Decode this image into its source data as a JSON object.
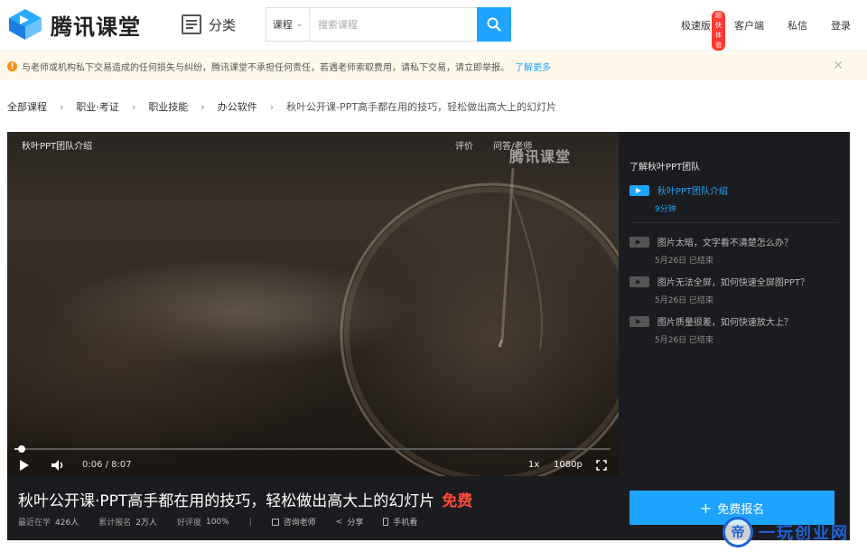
{
  "header": {
    "logo_text": "腾讯课堂",
    "category_label": "分类",
    "search": {
      "scope": "课程",
      "placeholder": "搜索课程"
    },
    "nav": {
      "fast": "极速版",
      "fast_badge": "超快体验",
      "client": "客户端",
      "messages": "私信",
      "login": "登录"
    }
  },
  "notice": {
    "text": "与老师或机构私下交易造成的任何损失与纠纷，腾讯课堂不承担任何责任，若遇老师索取费用，请私下交易，请立即举报。",
    "more": "了解更多"
  },
  "breadcrumb": [
    "全部课程",
    "职业·考证",
    "职业技能",
    "办公软件",
    "秋叶公开课-PPT高手都在用的技巧，轻松做出高大上的幻灯片"
  ],
  "player": {
    "title": "秋叶PPT团队介绍",
    "links": [
      "评价",
      "问答/老师"
    ],
    "watermark": "腾讯课堂",
    "time": "0:06 / 8:07",
    "speed": "1x",
    "quality": "1080p",
    "progress": 0.012
  },
  "side": {
    "heading": "了解秋叶PPT团队",
    "items": [
      {
        "title": "秋叶PPT团队介绍",
        "meta": "9分钟"
      },
      {
        "title": "图片太暗，文字看不清楚怎么办？",
        "meta": "5月26日  已结束"
      },
      {
        "title": "图片无法全屏，如何快速全屏图PPT？",
        "meta": "5月26日  已结束"
      },
      {
        "title": "图片质量很差，如何快速放大上？",
        "meta": "5月26日  已结束"
      }
    ]
  },
  "course": {
    "title": "秋叶公开课·PPT高手都在用的技巧，轻松做出高大上的幻灯片",
    "free": "免费",
    "stats": {
      "learning_label": "最近在学",
      "learning_value": "426人",
      "enrolled_label": "累计报名",
      "enrolled_value": "2万人",
      "rating_label": "好评度",
      "rating_value": "100%"
    },
    "actions": {
      "consult": "咨询老师",
      "share": "分享",
      "mobile": "手机看"
    },
    "enroll_label": "免费报名"
  },
  "stamp": {
    "text": "一玩创业网"
  },
  "colors": {
    "accent": "#1ea4ff",
    "free": "#ff4b3a"
  }
}
